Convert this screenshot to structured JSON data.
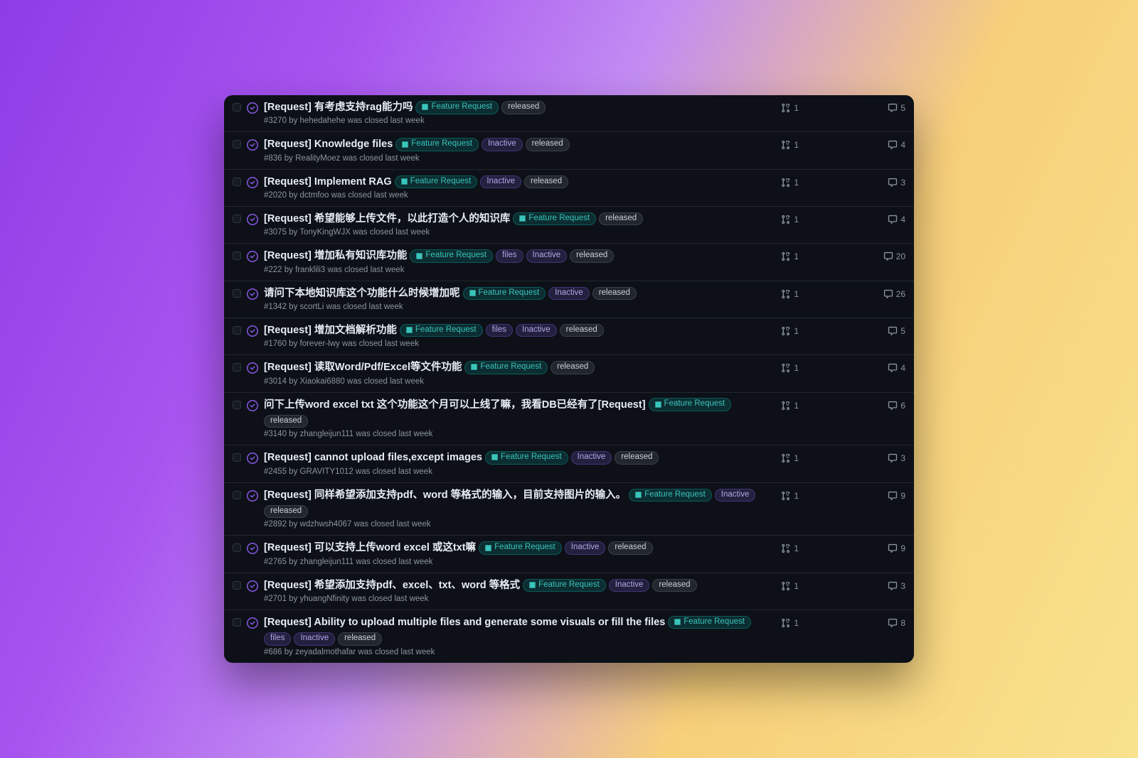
{
  "labels": {
    "feature_request": "Feature Request",
    "inactive": "Inactive",
    "released": "released",
    "files": "files"
  },
  "issues": [
    {
      "title": "[Request] 有考虑支持rag能力吗",
      "meta": "#3270 by hehedahehe was closed last week",
      "tags": [
        "feature",
        "released"
      ],
      "pr": "1",
      "comments": "5"
    },
    {
      "title": "[Request] Knowledge files",
      "meta": "#836 by RealityMoez was closed last week",
      "tags": [
        "feature",
        "inactive",
        "released"
      ],
      "pr": "1",
      "comments": "4"
    },
    {
      "title": "[Request] Implement RAG",
      "meta": "#2020 by dctmfoo was closed last week",
      "tags": [
        "feature",
        "inactive",
        "released"
      ],
      "pr": "1",
      "comments": "3"
    },
    {
      "title": "[Request] 希望能够上传文件，以此打造个人的知识库",
      "meta": "#3075 by TonyKingWJX was closed last week",
      "tags": [
        "feature",
        "released"
      ],
      "pr": "1",
      "comments": "4"
    },
    {
      "title": "[Request] 增加私有知识库功能",
      "meta": "#222 by franklili3 was closed last week",
      "tags": [
        "feature",
        "files",
        "inactive",
        "released"
      ],
      "pr": "1",
      "comments": "20"
    },
    {
      "title": "请问下本地知识库这个功能什么时候增加呢",
      "meta": "#1342 by scortLi was closed last week",
      "tags": [
        "feature",
        "inactive",
        "released"
      ],
      "pr": "1",
      "comments": "26"
    },
    {
      "title": "[Request] 增加文档解析功能",
      "meta": "#1760 by forever-lwy was closed last week",
      "tags": [
        "feature",
        "files",
        "inactive",
        "released"
      ],
      "pr": "1",
      "comments": "5"
    },
    {
      "title": "[Request] 读取Word/Pdf/Excel等文件功能",
      "meta": "#3014 by Xiaokai6880 was closed last week",
      "tags": [
        "feature",
        "released"
      ],
      "pr": "1",
      "comments": "4"
    },
    {
      "title": "问下上传word excel txt 这个功能这个月可以上线了嘛，我看DB已经有了[Request]",
      "meta": "#3140 by zhangleijun111 was closed last week",
      "tags": [
        "feature",
        "released"
      ],
      "pr": "1",
      "comments": "6"
    },
    {
      "title": "[Request] cannot upload files,except images",
      "meta": "#2455 by GRAVITY1012 was closed last week",
      "tags": [
        "feature",
        "inactive",
        "released"
      ],
      "pr": "1",
      "comments": "3"
    },
    {
      "title": "[Request] 同样希望添加支持pdf、word 等格式的输入，目前支持图片的输入。",
      "meta": "#2892 by wdzhwsh4067 was closed last week",
      "tags": [
        "feature",
        "inactive",
        "released"
      ],
      "pr": "1",
      "comments": "9"
    },
    {
      "title": "[Request] 可以支持上传word excel 或这txt嘛",
      "meta": "#2765 by zhangleijun111 was closed last week",
      "tags": [
        "feature",
        "inactive",
        "released"
      ],
      "pr": "1",
      "comments": "9"
    },
    {
      "title": "[Request] 希望添加支持pdf、excel、txt、word 等格式",
      "meta": "#2701 by yhuangNfinity was closed last week",
      "tags": [
        "feature",
        "inactive",
        "released"
      ],
      "pr": "1",
      "comments": "3"
    },
    {
      "title": "[Request] Ability to upload multiple files and generate some visuals or fill the files",
      "meta": "#686 by zeyadalmothafar was closed last week",
      "tags": [
        "feature",
        "files",
        "inactive",
        "released"
      ],
      "pr": "1",
      "comments": "8"
    }
  ]
}
